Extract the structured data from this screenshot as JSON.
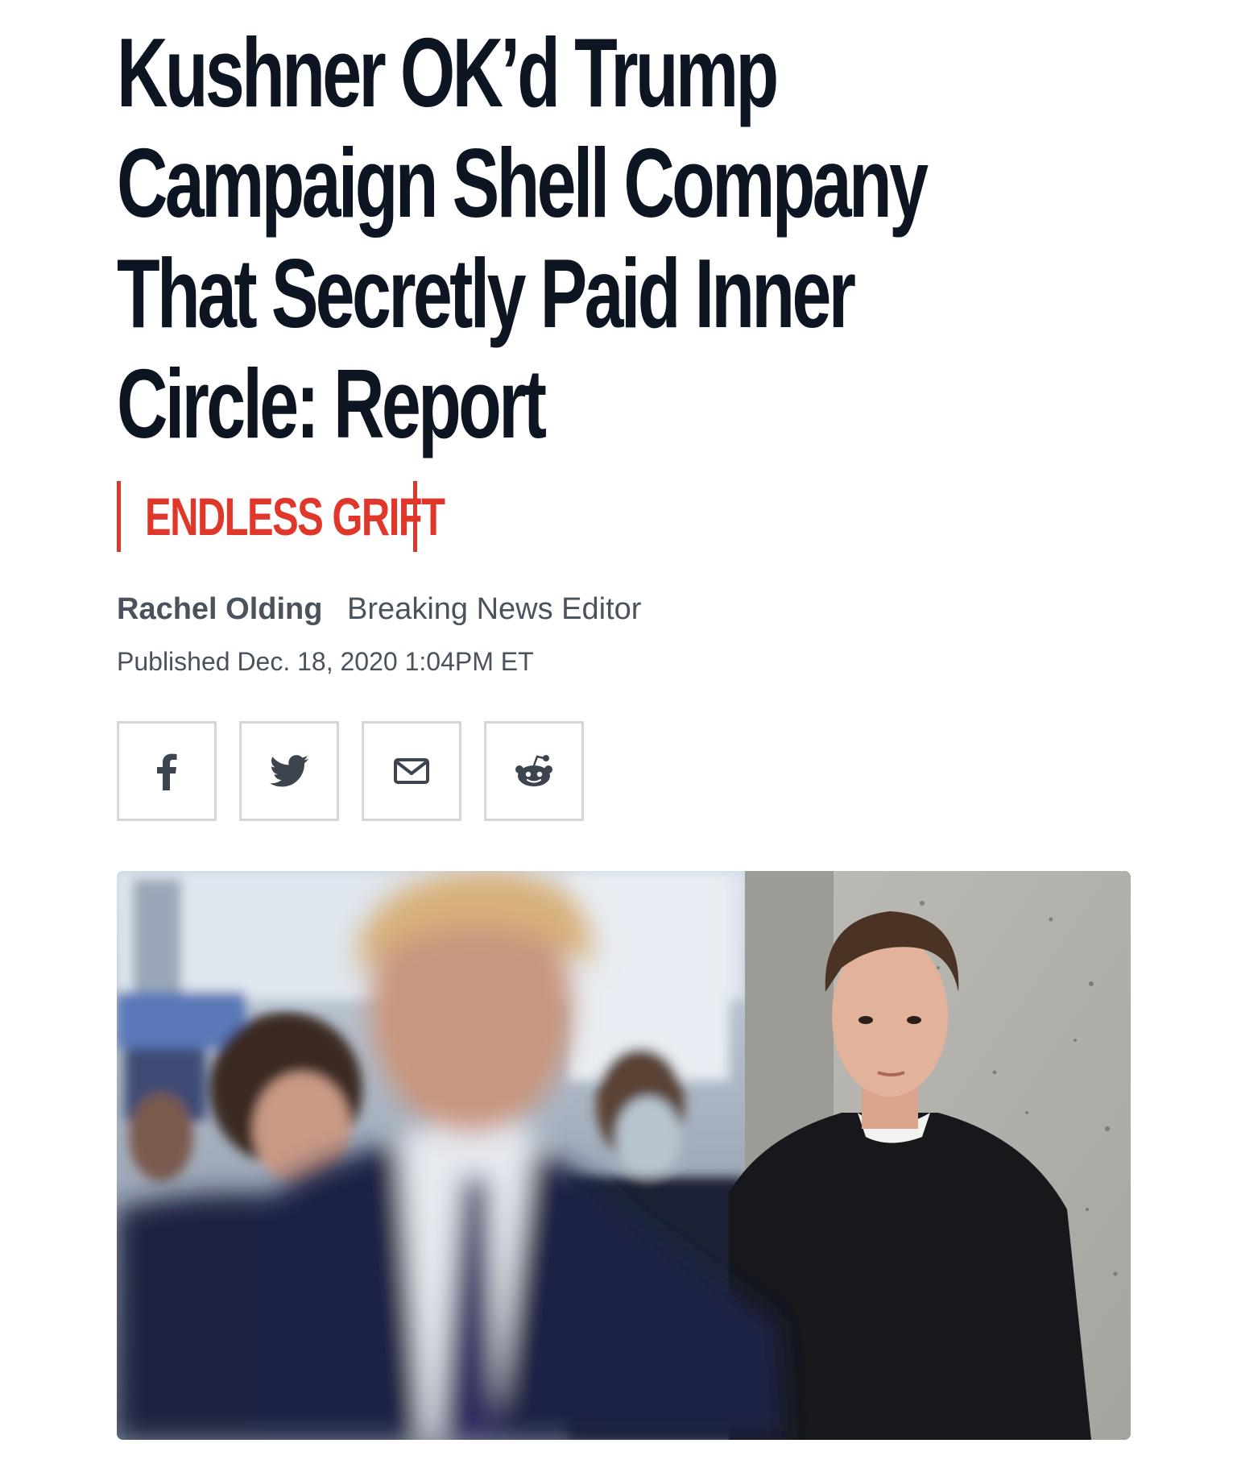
{
  "article": {
    "headline_lines": [
      "Kushner OK’d Trump",
      "Campaign Shell Company",
      "That Secretly Paid Inner",
      "Circle: Report"
    ],
    "kicker": "ENDLESS GRIFT",
    "author": "Rachel Olding",
    "author_title": "Breaking News Editor",
    "published": "Published Dec. 18, 2020 1:04PM ET"
  },
  "share": {
    "buttons": [
      {
        "icon": "facebook-icon"
      },
      {
        "icon": "twitter-icon"
      },
      {
        "icon": "email-icon"
      },
      {
        "icon": "reddit-icon"
      }
    ]
  },
  "colors": {
    "headline": "#0d1522",
    "kicker_accent": "#e0372b",
    "meta_text": "#4a525c",
    "share_border": "#d4d6d9",
    "share_icon": "#3c444e"
  }
}
